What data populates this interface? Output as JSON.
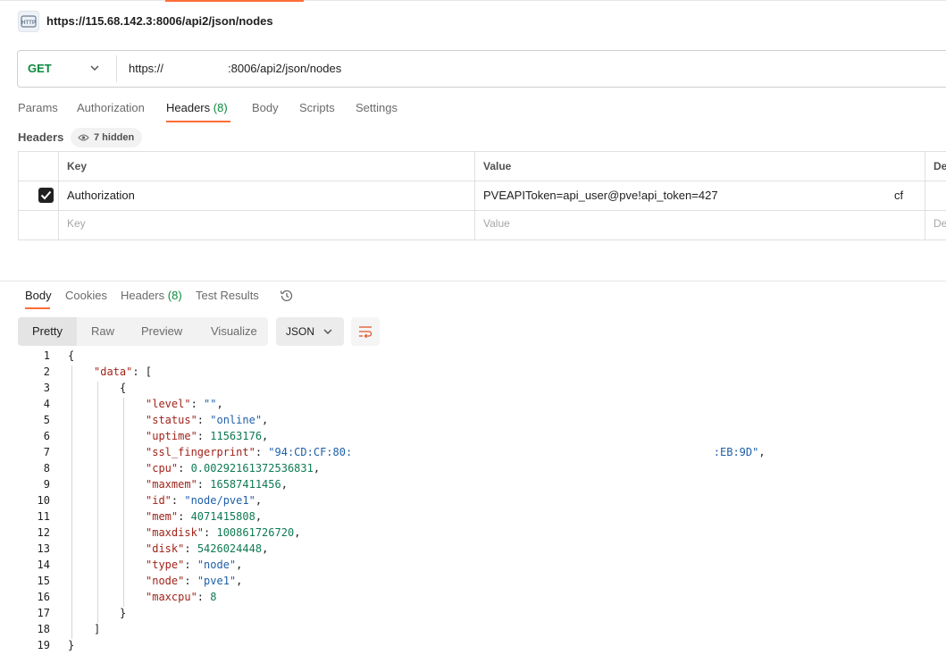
{
  "request": {
    "title": "https://115.68.142.3:8006/api2/json/nodes",
    "method": "GET",
    "url_part1": "https://",
    "url_part2": ":8006/api2/json/nodes"
  },
  "request_tabs": [
    {
      "label": "Params",
      "count": ""
    },
    {
      "label": "Authorization",
      "count": ""
    },
    {
      "label": "Headers",
      "count": "(8)"
    },
    {
      "label": "Body",
      "count": ""
    },
    {
      "label": "Scripts",
      "count": ""
    },
    {
      "label": "Settings",
      "count": ""
    }
  ],
  "headers_section": {
    "label": "Headers",
    "hidden_label": "7 hidden",
    "columns": [
      "Key",
      "Value",
      "De"
    ],
    "rows": [
      {
        "checked": true,
        "key": "Authorization",
        "value": "PVEAPIToken=api_user@pve!api_token=427",
        "value_tail": "cf"
      }
    ],
    "placeholder_key": "Key",
    "placeholder_value": "Value",
    "placeholder_desc": "De"
  },
  "response_tabs": [
    {
      "label": "Body",
      "count": ""
    },
    {
      "label": "Cookies",
      "count": ""
    },
    {
      "label": "Headers",
      "count": "(8)"
    },
    {
      "label": "Test Results",
      "count": ""
    }
  ],
  "view_modes": [
    "Pretty",
    "Raw",
    "Preview",
    "Visualize"
  ],
  "format": "JSON",
  "code_lines": [
    {
      "n": "1",
      "indent": 0,
      "parts": [
        [
          "p",
          "{"
        ]
      ]
    },
    {
      "n": "2",
      "indent": 1,
      "parts": [
        [
          "k",
          "\"data\""
        ],
        [
          "p",
          ": ["
        ]
      ]
    },
    {
      "n": "3",
      "indent": 2,
      "parts": [
        [
          "p",
          "{"
        ]
      ]
    },
    {
      "n": "4",
      "indent": 3,
      "parts": [
        [
          "k",
          "\"level\""
        ],
        [
          "p",
          ": "
        ],
        [
          "s",
          "\"\""
        ],
        [
          "p",
          ","
        ]
      ]
    },
    {
      "n": "5",
      "indent": 3,
      "parts": [
        [
          "k",
          "\"status\""
        ],
        [
          "p",
          ": "
        ],
        [
          "s",
          "\"online\""
        ],
        [
          "p",
          ","
        ]
      ]
    },
    {
      "n": "6",
      "indent": 3,
      "parts": [
        [
          "k",
          "\"uptime\""
        ],
        [
          "p",
          ": "
        ],
        [
          "n",
          "11563176"
        ],
        [
          "p",
          ","
        ]
      ]
    },
    {
      "n": "7",
      "indent": 3,
      "parts": [
        [
          "k",
          "\"ssl_fingerprint\""
        ],
        [
          "p",
          ": "
        ],
        [
          "s",
          "\"94:CD:CF:80:"
        ],
        [
          "s",
          "                                                        :EB:9D\""
        ],
        [
          "p",
          ","
        ]
      ]
    },
    {
      "n": "8",
      "indent": 3,
      "parts": [
        [
          "k",
          "\"cpu\""
        ],
        [
          "p",
          ": "
        ],
        [
          "n",
          "0.00292161372536831"
        ],
        [
          "p",
          ","
        ]
      ]
    },
    {
      "n": "9",
      "indent": 3,
      "parts": [
        [
          "k",
          "\"maxmem\""
        ],
        [
          "p",
          ": "
        ],
        [
          "n",
          "16587411456"
        ],
        [
          "p",
          ","
        ]
      ]
    },
    {
      "n": "10",
      "indent": 3,
      "parts": [
        [
          "k",
          "\"id\""
        ],
        [
          "p",
          ": "
        ],
        [
          "s",
          "\"node/pve1\""
        ],
        [
          "p",
          ","
        ]
      ]
    },
    {
      "n": "11",
      "indent": 3,
      "parts": [
        [
          "k",
          "\"mem\""
        ],
        [
          "p",
          ": "
        ],
        [
          "n",
          "4071415808"
        ],
        [
          "p",
          ","
        ]
      ]
    },
    {
      "n": "12",
      "indent": 3,
      "parts": [
        [
          "k",
          "\"maxdisk\""
        ],
        [
          "p",
          ": "
        ],
        [
          "n",
          "100861726720"
        ],
        [
          "p",
          ","
        ]
      ]
    },
    {
      "n": "13",
      "indent": 3,
      "parts": [
        [
          "k",
          "\"disk\""
        ],
        [
          "p",
          ": "
        ],
        [
          "n",
          "5426024448"
        ],
        [
          "p",
          ","
        ]
      ]
    },
    {
      "n": "14",
      "indent": 3,
      "parts": [
        [
          "k",
          "\"type\""
        ],
        [
          "p",
          ": "
        ],
        [
          "s",
          "\"node\""
        ],
        [
          "p",
          ","
        ]
      ]
    },
    {
      "n": "15",
      "indent": 3,
      "parts": [
        [
          "k",
          "\"node\""
        ],
        [
          "p",
          ": "
        ],
        [
          "s",
          "\"pve1\""
        ],
        [
          "p",
          ","
        ]
      ]
    },
    {
      "n": "16",
      "indent": 3,
      "parts": [
        [
          "k",
          "\"maxcpu\""
        ],
        [
          "p",
          ": "
        ],
        [
          "n",
          "8"
        ]
      ]
    },
    {
      "n": "17",
      "indent": 2,
      "parts": [
        [
          "p",
          "}"
        ]
      ]
    },
    {
      "n": "18",
      "indent": 1,
      "parts": [
        [
          "p",
          "]"
        ]
      ]
    },
    {
      "n": "19",
      "indent": 0,
      "parts": [
        [
          "p",
          "}"
        ]
      ]
    }
  ],
  "colors": {
    "accent": "#ff6c37",
    "method": "#0b8a3e",
    "key": "#a0241b",
    "string": "#1f5fa8",
    "number": "#0e7a53"
  }
}
